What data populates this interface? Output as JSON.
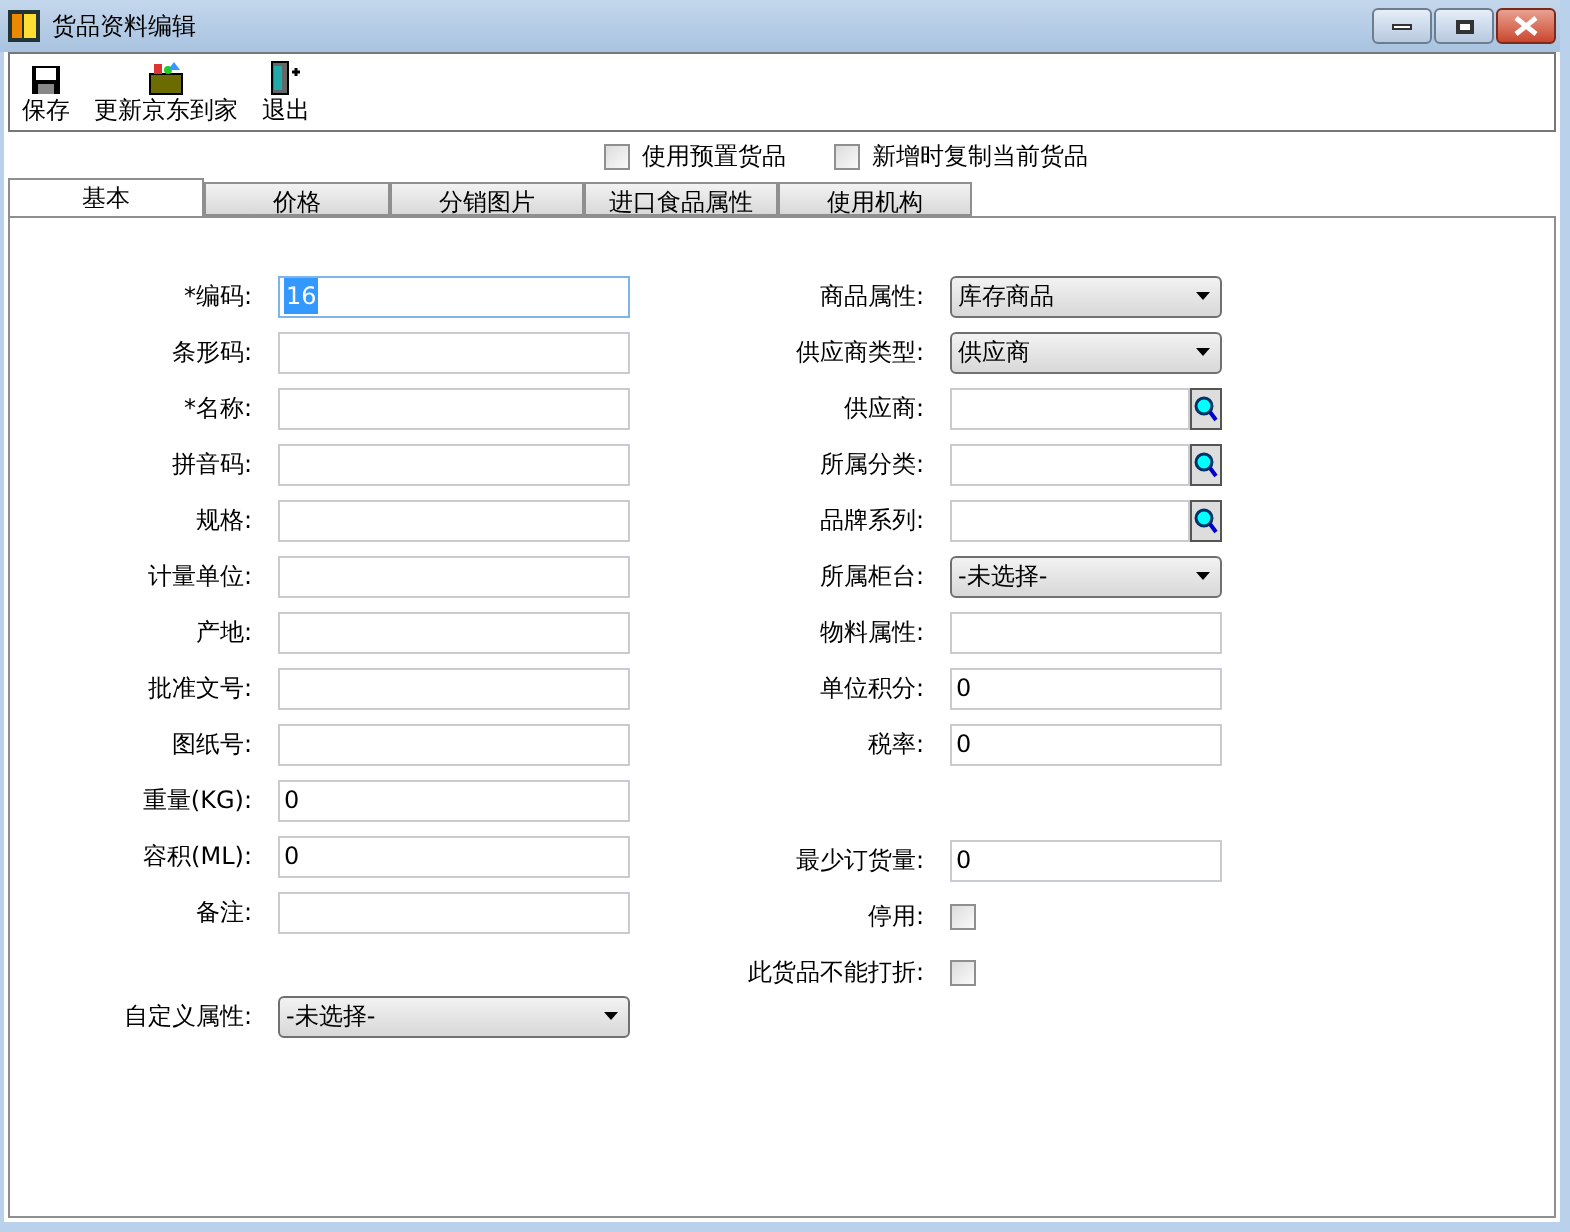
{
  "window": {
    "title": "货品资料编辑"
  },
  "toolbar": [
    {
      "label": "保存",
      "kind": "save"
    },
    {
      "label": "更新京东到家",
      "kind": "package"
    },
    {
      "label": "退出",
      "kind": "exit"
    }
  ],
  "options": [
    {
      "label": "使用预置货品",
      "checked": false
    },
    {
      "label": "新增时复制当前货品",
      "checked": false
    }
  ],
  "tabs": [
    {
      "label": "基本",
      "selected": true
    },
    {
      "label": "价格",
      "selected": false
    },
    {
      "label": "分销图片",
      "selected": false
    },
    {
      "label": "进口食品属性",
      "selected": false
    },
    {
      "label": "使用机构",
      "selected": false
    }
  ],
  "left_fields": [
    [
      {
        "label": "*编码:",
        "kind": "text",
        "value": "16",
        "focused": true
      },
      {
        "label": "条形码:",
        "kind": "text"
      },
      {
        "label": "*名称:",
        "kind": "text"
      },
      {
        "label": "拼音码:",
        "kind": "text"
      },
      {
        "label": "规格:",
        "kind": "text"
      },
      {
        "label": "计量单位:",
        "kind": "text"
      },
      {
        "label": "产地:",
        "kind": "text"
      },
      {
        "label": "批准文号:",
        "kind": "text"
      },
      {
        "label": "图纸号:",
        "kind": "text"
      },
      {
        "label": "重量(KG):",
        "kind": "text",
        "value": "0"
      },
      {
        "label": "容积(ML):",
        "kind": "text",
        "value": "0"
      },
      {
        "label": "备注:",
        "kind": "text"
      }
    ],
    [
      {
        "label": "自定义属性:",
        "kind": "select",
        "value": "-未选择-"
      }
    ]
  ],
  "right_fields": [
    [
      {
        "label": "商品属性:",
        "kind": "select",
        "value": "库存商品"
      },
      {
        "label": "供应商类型:",
        "kind": "select",
        "value": "供应商"
      },
      {
        "label": "供应商:",
        "kind": "lookup"
      },
      {
        "label": "所属分类:",
        "kind": "lookup"
      },
      {
        "label": "品牌系列:",
        "kind": "lookup"
      },
      {
        "label": "所属柜台:",
        "kind": "select",
        "value": "-未选择-"
      },
      {
        "label": "物料属性:",
        "kind": "text"
      },
      {
        "label": "单位积分:",
        "kind": "text",
        "value": "0"
      },
      {
        "label": "税率:",
        "kind": "text",
        "value": "0"
      }
    ],
    [
      {
        "label": "最少订货量:",
        "kind": "text",
        "value": "0"
      },
      {
        "label": "停用:",
        "kind": "checkbox",
        "checked": false
      },
      {
        "label": "此货品不能打折:",
        "kind": "checkbox",
        "checked": false
      }
    ]
  ]
}
